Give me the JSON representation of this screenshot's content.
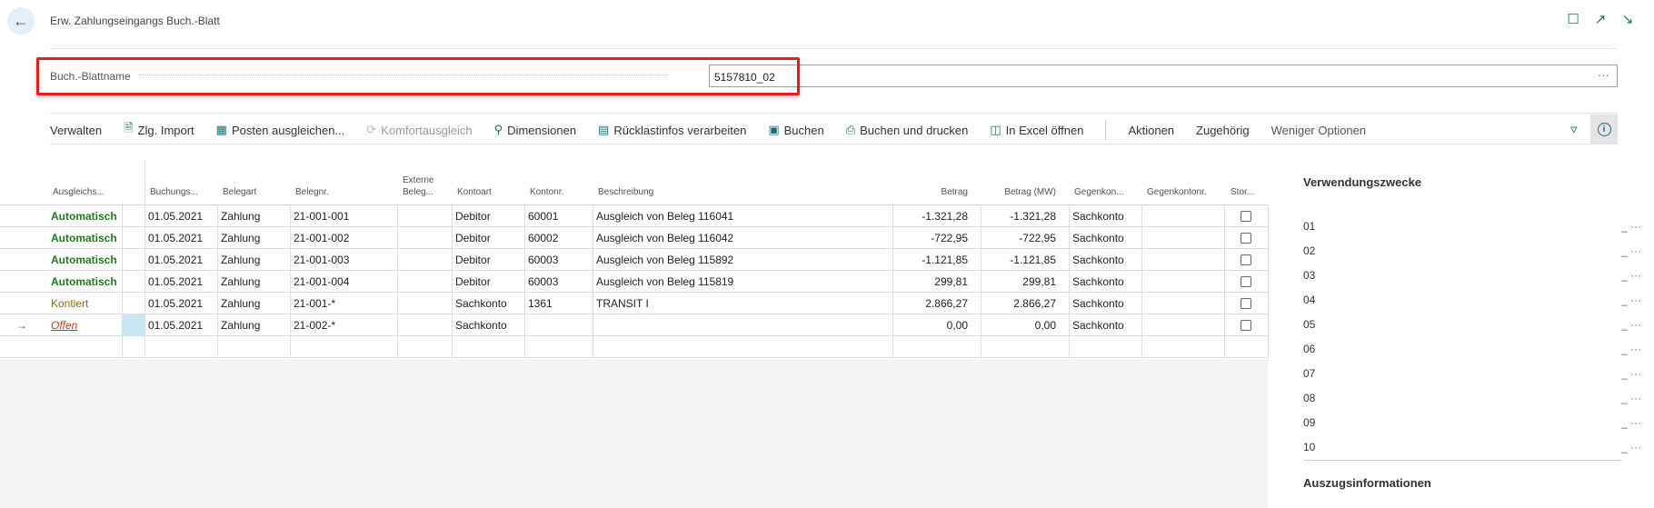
{
  "header": {
    "title": "Erw. Zahlungseingangs Buch.-Blatt",
    "icons": [
      "back-arrow-icon",
      "bookmark-icon",
      "open-new-window-icon",
      "collapse-icon"
    ]
  },
  "batch": {
    "label": "Buch.-Blattname",
    "value": "5157810_02",
    "more": "···"
  },
  "actions": [
    {
      "label": "Verwalten"
    },
    {
      "label": "Zlg. Import"
    },
    {
      "label": "Posten ausgleichen..."
    },
    {
      "label": "Komfortausgleich"
    },
    {
      "label": "Dimensionen"
    },
    {
      "label": "Rücklastinfos verarbeiten"
    },
    {
      "label": "Buchen"
    },
    {
      "label": "Buchen und drucken"
    },
    {
      "label": "In Excel öffnen"
    },
    {
      "label": "Aktionen"
    },
    {
      "label": "Zugehörig"
    },
    {
      "label": "Weniger Optionen"
    }
  ],
  "grid": {
    "headers": {
      "status": "Ausgleichs...",
      "buchungsdatum": "Buchungs...",
      "belegart": "Belegart",
      "belegnr": "Belegnr.",
      "externe1": "Externe",
      "externe2": "Beleg...",
      "kontoart": "Kontoart",
      "kontonr": "Kontonr.",
      "beschreibung": "Beschreibung",
      "betrag": "Betrag",
      "betragmw": "Betrag (MW)",
      "gegenkontoart": "Gegenkon...",
      "gegenkontonr": "Gegenkontonr.",
      "storno": "Stor..."
    },
    "rows": [
      {
        "status": "Automatisch",
        "date": "01.05.2021",
        "type": "Zahlung",
        "doc": "21-001-001",
        "acct_type": "Debitor",
        "acct_no": "60001",
        "desc": "Ausgleich von Beleg 116041",
        "amount": "-1.321,28",
        "amount_lcy": "-1.321,28",
        "bal_type": "Sachkonto"
      },
      {
        "status": "Automatisch",
        "date": "01.05.2021",
        "type": "Zahlung",
        "doc": "21-001-002",
        "acct_type": "Debitor",
        "acct_no": "60002",
        "desc": "Ausgleich von Beleg 116042",
        "amount": "-722,95",
        "amount_lcy": "-722,95",
        "bal_type": "Sachkonto"
      },
      {
        "status": "Automatisch",
        "date": "01.05.2021",
        "type": "Zahlung",
        "doc": "21-001-003",
        "acct_type": "Debitor",
        "acct_no": "60003",
        "desc": "Ausgleich von Beleg 115892",
        "amount": "-1.121,85",
        "amount_lcy": "-1.121,85",
        "bal_type": "Sachkonto"
      },
      {
        "status": "Automatisch",
        "date": "01.05.2021",
        "type": "Zahlung",
        "doc": "21-001-004",
        "acct_type": "Debitor",
        "acct_no": "60003",
        "desc": "Ausgleich von Beleg 115819",
        "amount": "299,81",
        "amount_lcy": "299,81",
        "bal_type": "Sachkonto"
      },
      {
        "status": "Kontiert",
        "date": "01.05.2021",
        "type": "Zahlung",
        "doc": "21-001-*",
        "acct_type": "Sachkonto",
        "acct_no": "1361",
        "desc": "TRANSIT I",
        "amount": "2.866,27",
        "amount_lcy": "2.866,27",
        "bal_type": "Sachkonto"
      },
      {
        "status": "Offen",
        "date": "01.05.2021",
        "type": "Zahlung",
        "doc": "21-002-*",
        "acct_type": "Sachkonto",
        "acct_no": "",
        "desc": "",
        "amount": "0,00",
        "amount_lcy": "0,00",
        "bal_type": "Sachkonto"
      }
    ]
  },
  "right_panel": {
    "title": "Verwendungszwecke",
    "lines": [
      "01",
      "02",
      "03",
      "04",
      "05",
      "06",
      "07",
      "08",
      "09",
      "10"
    ],
    "line_suffix": "_ ···",
    "title2": "Auszugsinformationen"
  },
  "colors": {
    "accent": "#1c6e74",
    "auto_green": "#1f7a1f",
    "kontiert_olive": "#8a6d00",
    "offen_red": "#c0392b",
    "highlight_red": "#e02020"
  }
}
